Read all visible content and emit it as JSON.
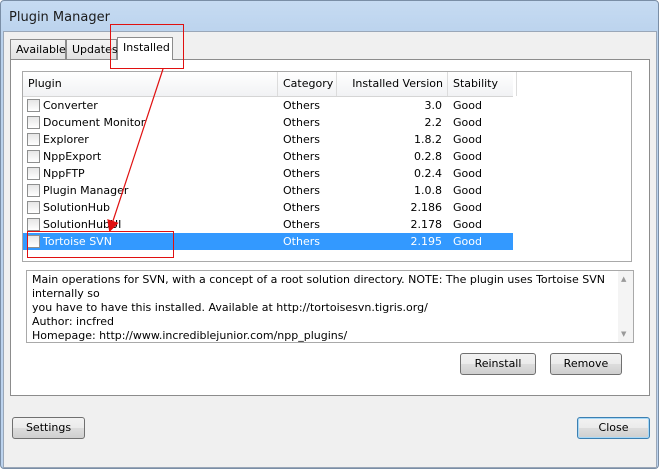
{
  "window": {
    "title": "Plugin Manager"
  },
  "tabs": [
    {
      "label": "Available",
      "active": false
    },
    {
      "label": "Updates",
      "active": false
    },
    {
      "label": "Installed",
      "active": true
    }
  ],
  "list": {
    "columns": {
      "plugin": "Plugin",
      "category": "Category",
      "version": "Installed Version",
      "stability": "Stability"
    },
    "rows": [
      {
        "name": "Converter",
        "category": "Others",
        "version": "3.0",
        "stability": "Good",
        "checked": false,
        "selected": false
      },
      {
        "name": "Document Monitor",
        "category": "Others",
        "version": "2.2",
        "stability": "Good",
        "checked": false,
        "selected": false
      },
      {
        "name": "Explorer",
        "category": "Others",
        "version": "1.8.2",
        "stability": "Good",
        "checked": false,
        "selected": false
      },
      {
        "name": "NppExport",
        "category": "Others",
        "version": "0.2.8",
        "stability": "Good",
        "checked": false,
        "selected": false
      },
      {
        "name": "NppFTP",
        "category": "Others",
        "version": "0.2.4",
        "stability": "Good",
        "checked": false,
        "selected": false
      },
      {
        "name": "Plugin Manager",
        "category": "Others",
        "version": "1.0.8",
        "stability": "Good",
        "checked": false,
        "selected": false
      },
      {
        "name": "SolutionHub",
        "category": "Others",
        "version": "2.186",
        "stability": "Good",
        "checked": false,
        "selected": false
      },
      {
        "name": "SolutionHubUI",
        "category": "Others",
        "version": "2.178",
        "stability": "Good",
        "checked": false,
        "selected": false
      },
      {
        "name": "Tortoise SVN",
        "category": "Others",
        "version": "2.195",
        "stability": "Good",
        "checked": false,
        "selected": true
      }
    ]
  },
  "description": {
    "line1": "Main operations for SVN, with a concept of a root solution directory. NOTE: The plugin uses Tortoise SVN internally so",
    "line2": "you have to have this installed. Available at http://tortoisesvn.tigris.org/",
    "line3": "Author: incfred",
    "line4": "Homepage: http://www.incrediblejunior.com/npp_plugins/"
  },
  "buttons": {
    "reinstall": "Reinstall",
    "remove": "Remove",
    "settings": "Settings",
    "close": "Close"
  },
  "annotation_color": "#e01010",
  "selection_color": "#3399ff"
}
